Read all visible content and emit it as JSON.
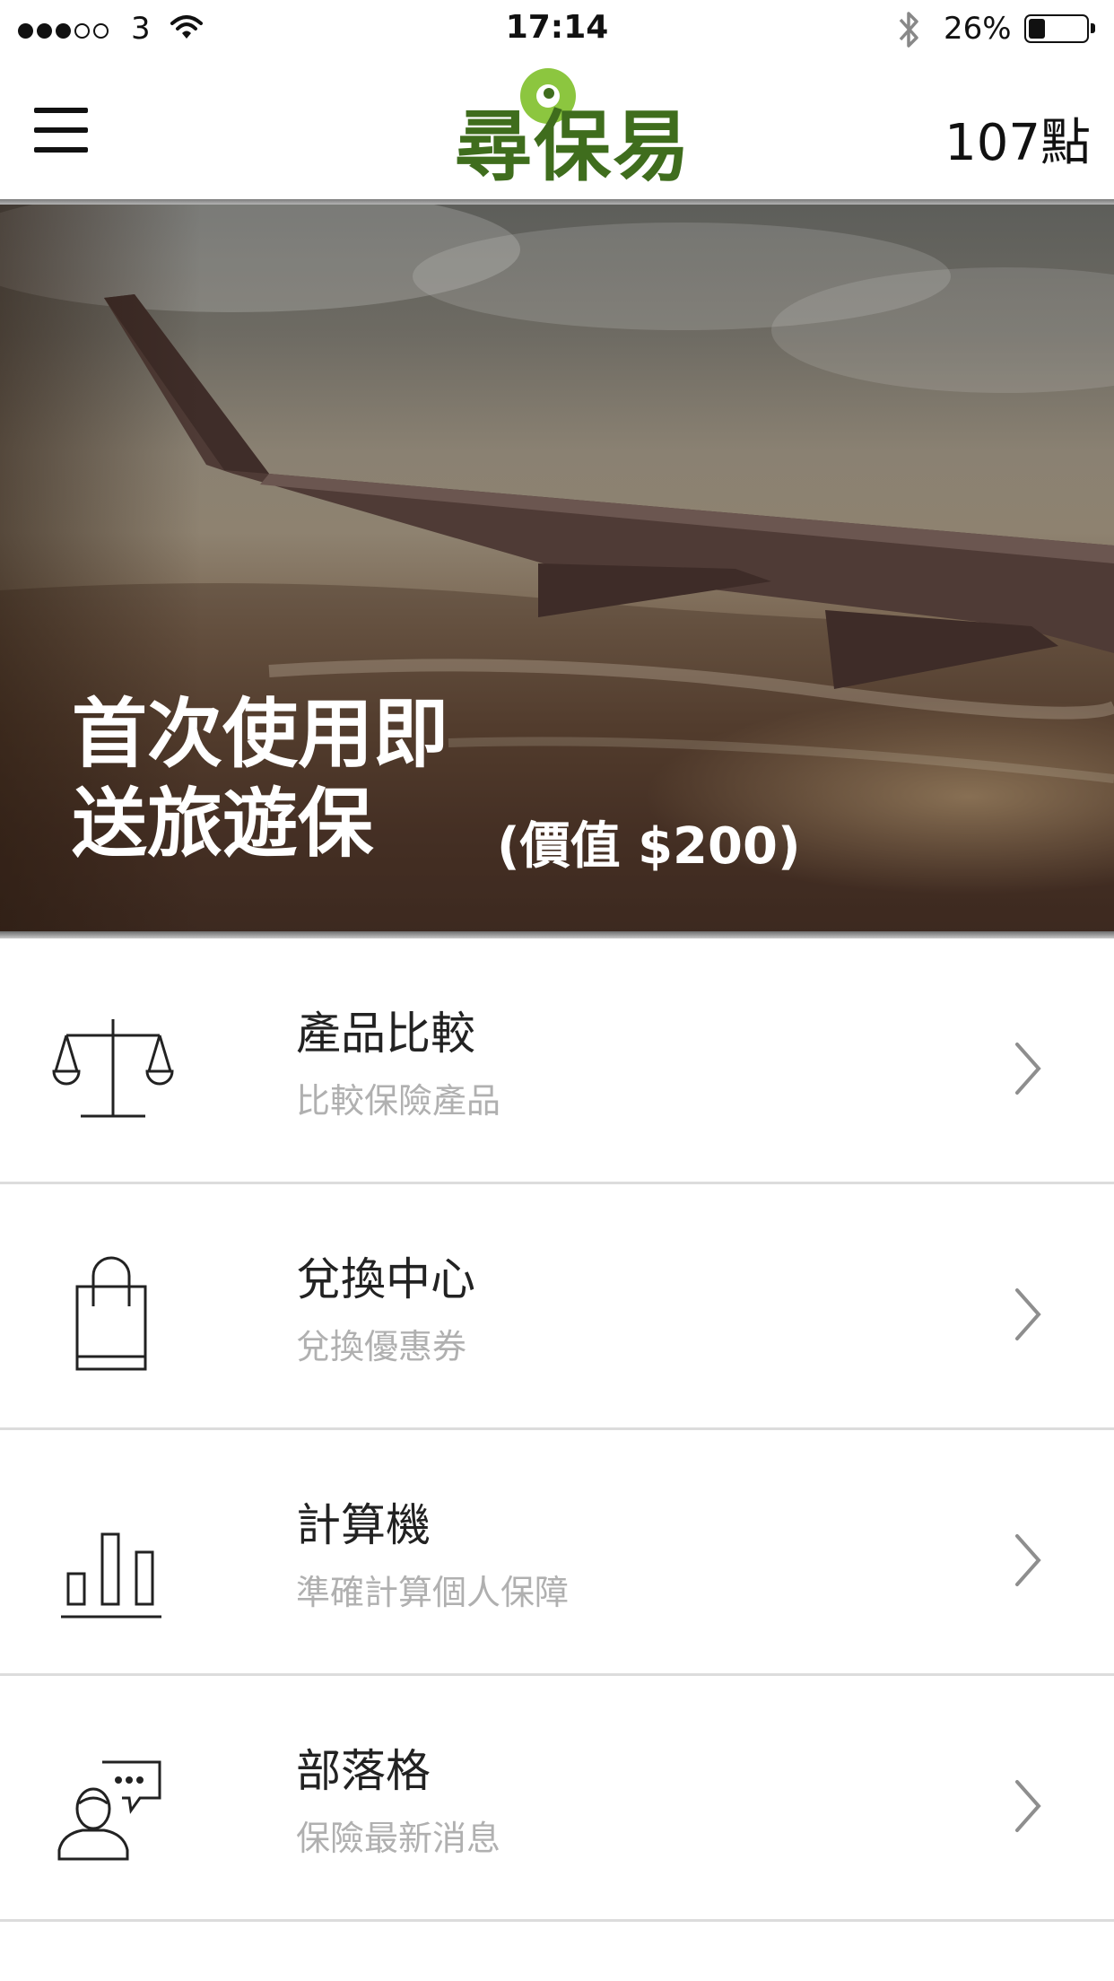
{
  "status_bar": {
    "carrier": "3",
    "time": "17:14",
    "battery_percent": "26%",
    "battery_level": 0.26,
    "icons": [
      "signal-dots-icon",
      "wifi-icon",
      "bluetooth-icon",
      "battery-icon"
    ]
  },
  "nav": {
    "menu_icon": "hamburger-menu-icon",
    "logo_text": "尋保易",
    "points": "107點"
  },
  "hero": {
    "title_line1": "首次使用即",
    "title_line2": "送旅遊保",
    "value": "(價值 $200)"
  },
  "menu": {
    "items": [
      {
        "title": "產品比較",
        "subtitle": "比較保險產品",
        "icon": "scale-icon"
      },
      {
        "title": "兌換中心",
        "subtitle": "兌換優惠券",
        "icon": "shopping-bag-icon"
      },
      {
        "title": "計算機",
        "subtitle": "準確計算個人保障",
        "icon": "bar-chart-icon"
      },
      {
        "title": "部落格",
        "subtitle": "保險最新消息",
        "icon": "blog-chat-person-icon"
      }
    ],
    "chevron_icon": "chevron-right-icon"
  },
  "colors": {
    "logo_dark_green": "#3f6d1d",
    "logo_light_green": "#8cc63f",
    "subtitle_gray": "#b0b0b0",
    "divider": "#dcdcdc"
  }
}
